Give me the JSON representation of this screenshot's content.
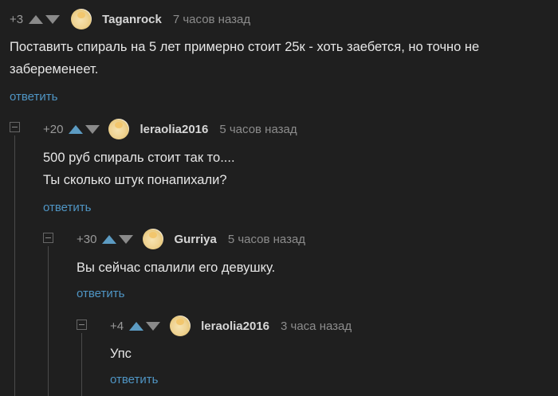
{
  "comments": [
    {
      "rating": "+3",
      "username": "Taganrock",
      "time": "7 часов назад",
      "text_line1": "Поставить спираль на 5 лет примерно стоит 25к - хоть заебется, но точно не",
      "text_line2": "забеременеет.",
      "reply_label": "ответить"
    },
    {
      "rating": "+20",
      "username": "leraolia2016",
      "time": "5 часов назад",
      "text_line1": "500 руб спираль стоит так то....",
      "text_line2": "Ты сколько штук понапихали?",
      "reply_label": "ответить"
    },
    {
      "rating": "+30",
      "username": "Gurriya",
      "time": "5 часов назад",
      "text_line1": "Вы сейчас спалили его девушку.",
      "reply_label": "ответить"
    },
    {
      "rating": "+4",
      "username": "leraolia2016",
      "time": "3 часа назад",
      "text_line1": "Упс",
      "reply_label": "ответить"
    }
  ],
  "colors": {
    "background": "#1f1f1f",
    "link": "#4f95c4",
    "upvote_active": "#5c9bc2"
  },
  "icons": {
    "upvote": "arrow-up-icon",
    "downvote": "arrow-down-icon",
    "collapse": "collapse-icon"
  }
}
